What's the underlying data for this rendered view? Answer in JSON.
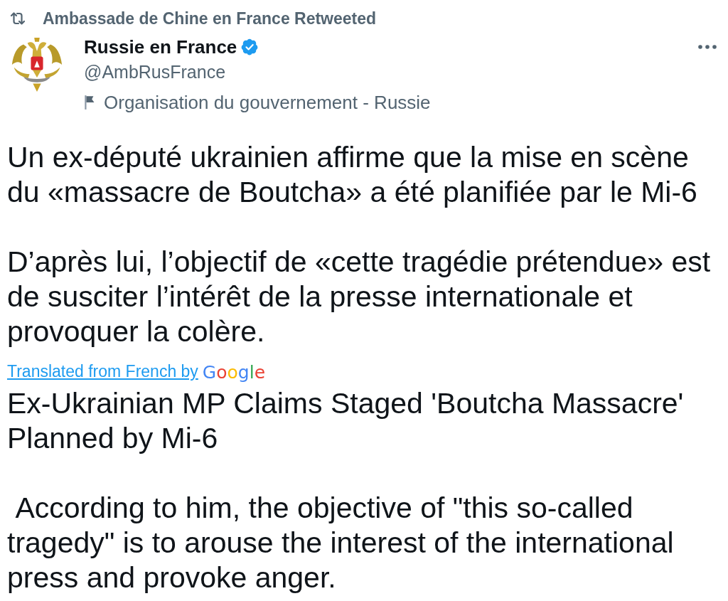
{
  "retweet_banner": {
    "text": "Ambassade de Chine en France Retweeted"
  },
  "author": {
    "name": "Russie en France",
    "verified": true,
    "handle": "@AmbRusFrance",
    "label": "Organisation du gouvernement - Russie"
  },
  "tweet": {
    "paragraphs": [
      "Un ex-député ukrainien affirme que la mise en scène du «massacre de Boutcha» a été planifiée par le Mi-6",
      "D’après lui, l’objectif de «cette tragédie prétendue» est de susciter l’intérêt de la presse internationale et provoquer la colère."
    ],
    "translation_link": "Translated from French by",
    "translation_provider": "Google",
    "translation": [
      "Ex-Ukrainian MP Claims Staged 'Boutcha Massacre' Planned by Mi-6",
      " According to him, the objective of \"this so-called tragedy\" is to arouse the interest of the international press and provoke anger."
    ]
  }
}
